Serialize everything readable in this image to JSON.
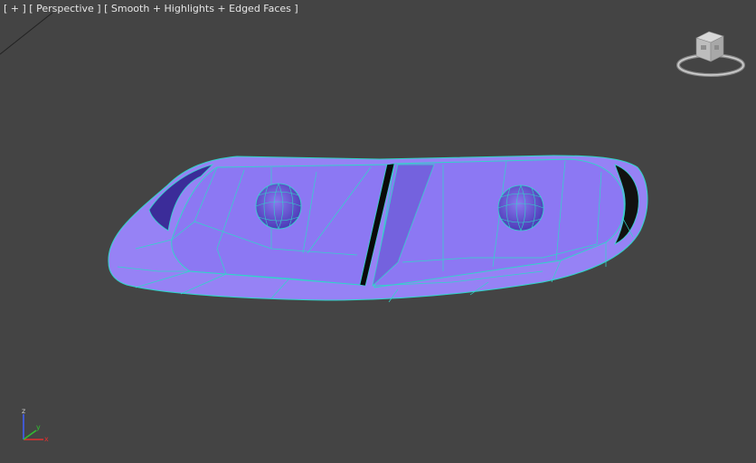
{
  "viewport": {
    "label_plus": "[ + ]",
    "label_view": "[ Perspective ]",
    "label_shading": "[ Smooth + Highlights + Edged Faces ]"
  },
  "axis": {
    "z": "z",
    "x": "x",
    "y": "y"
  },
  "colors": {
    "background": "#444444",
    "mesh_face": "#8f7bf2",
    "mesh_edge": "#2fd6c8",
    "label_text": "#e6e6e6",
    "axis_x": "#e03030",
    "axis_y": "#30c030",
    "axis_z": "#4060ff"
  },
  "icons": {
    "viewcube": "viewcube-icon",
    "axis": "axis-tripod-icon"
  }
}
